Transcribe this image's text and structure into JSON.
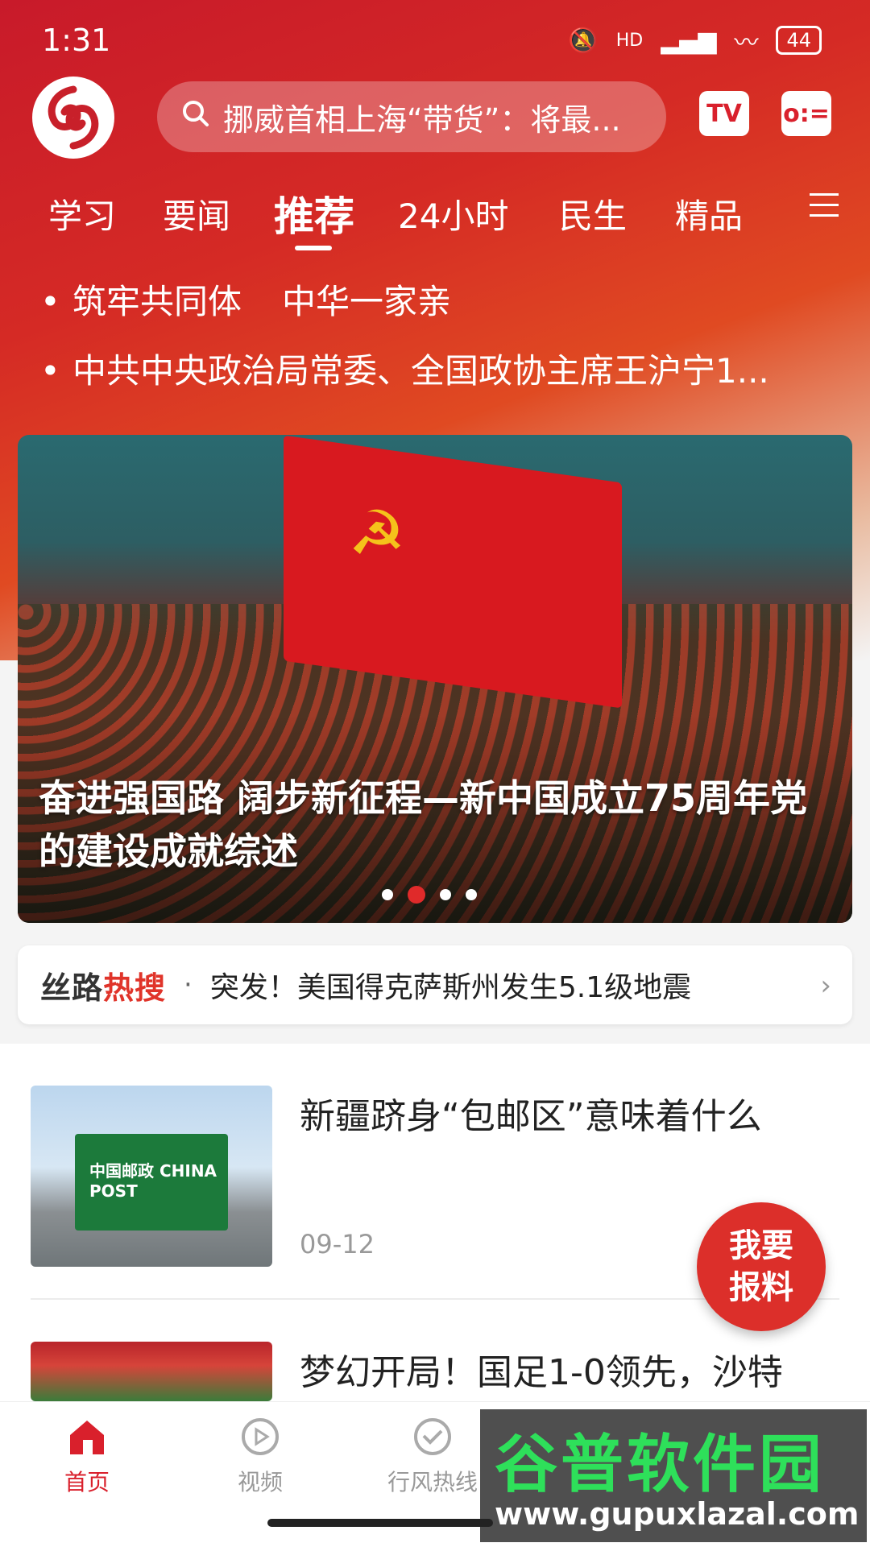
{
  "status_bar": {
    "time": "1:31",
    "network": "HD",
    "battery": "44"
  },
  "search": {
    "placeholder": "挪威首相上海“带货”：将最..."
  },
  "header_buttons": {
    "tv": "TV",
    "radio": "o:="
  },
  "tabs": [
    {
      "label": "学习"
    },
    {
      "label": "要闻"
    },
    {
      "label": "推荐",
      "active": true
    },
    {
      "label": "24小时"
    },
    {
      "label": "民生"
    },
    {
      "label": "精品"
    }
  ],
  "headlines": {
    "first_a": "筑牢共同体",
    "first_b": "中华一家亲",
    "second": "中共中央政治局常委、全国政协主席王沪宁1..."
  },
  "banner": {
    "title": "奋进强国路 阔步新征程—新中国成立75周年党的建设成就综述",
    "slides": 4,
    "active_slide": 2
  },
  "hot_search": {
    "brand_a": "丝路",
    "brand_b": "热搜",
    "separator": "·",
    "text": "突发！美国得克萨斯州发生5.1级地震"
  },
  "news": [
    {
      "title": "新疆跻身“包邮区”意味着什么",
      "date": "09-12",
      "thumb_text": "中国邮政 CHINA POST"
    },
    {
      "title": "梦幻开局！国足1-0领先，沙特"
    }
  ],
  "report_button": {
    "line1": "我要",
    "line2": "报料"
  },
  "bottom_nav": [
    {
      "label": "首页",
      "icon": "home-icon",
      "active": true
    },
    {
      "label": "视频",
      "icon": "play-icon"
    },
    {
      "label": "行风热线",
      "icon": "hotline-icon"
    }
  ],
  "watermark": {
    "title": "谷普软件园",
    "url": "www.gupuxlazal.com"
  },
  "colors": {
    "brand_red": "#d9202c",
    "hot_red": "#e0342a"
  }
}
